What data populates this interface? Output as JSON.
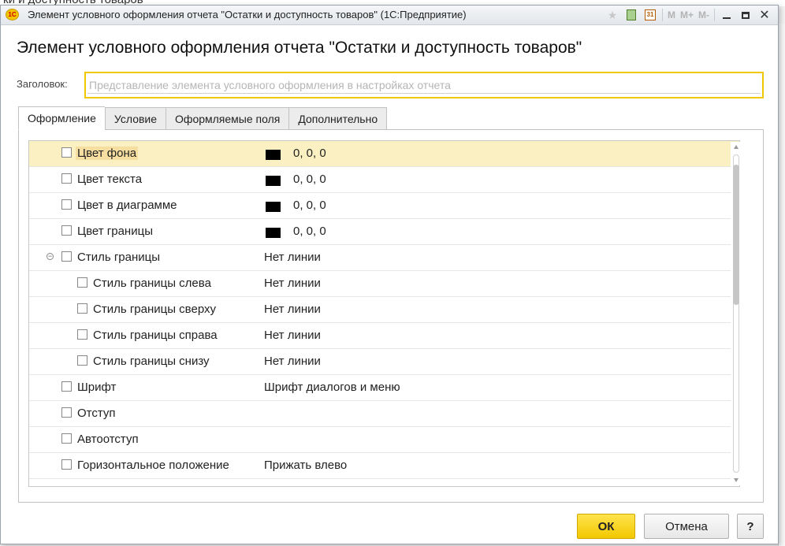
{
  "background": {
    "fragment": "ки и доступность товаров"
  },
  "window": {
    "title": "Элемент условного оформления отчета \"Остатки и доступность товаров\"  (1С:Предприятие)",
    "logo": "1С",
    "toolbar_icons": [
      "favorite-icon",
      "calculator-icon",
      "calendar-icon",
      "memory-m-icon",
      "memory-plus-icon",
      "memory-minus-icon",
      "minimize-icon",
      "maximize-icon",
      "close-icon"
    ],
    "calendar_day": "31",
    "memory": {
      "m": "M",
      "mplus": "M+",
      "mminus": "M-"
    }
  },
  "heading": "Элемент условного оформления отчета \"Остатки и доступность товаров\"",
  "caption": {
    "label": "Заголовок:",
    "value": "",
    "placeholder": "Представление элемента условного оформления в настройках отчета"
  },
  "tabs": [
    {
      "label": "Оформление",
      "active": true
    },
    {
      "label": "Условие",
      "active": false
    },
    {
      "label": "Оформляемые поля",
      "active": false
    },
    {
      "label": "Дополнительно",
      "active": false
    }
  ],
  "rows": [
    {
      "name": "Цвет фона",
      "value": "0, 0, 0",
      "swatch_color": "#000000",
      "checked": false,
      "indent": 0,
      "selected": true
    },
    {
      "name": "Цвет текста",
      "value": "0, 0, 0",
      "swatch_color": "#000000",
      "checked": false,
      "indent": 0
    },
    {
      "name": "Цвет в диаграмме",
      "value": "0, 0, 0",
      "swatch_color": "#000000",
      "checked": false,
      "indent": 0
    },
    {
      "name": "Цвет границы",
      "value": "0, 0, 0",
      "swatch_color": "#000000",
      "checked": false,
      "indent": 0
    },
    {
      "name": "Стиль границы",
      "value": "Нет линии",
      "checked": false,
      "indent": 0,
      "expandable": true,
      "expanded": true
    },
    {
      "name": "Стиль границы слева",
      "value": "Нет линии",
      "checked": false,
      "indent": 1
    },
    {
      "name": "Стиль границы сверху",
      "value": "Нет линии",
      "checked": false,
      "indent": 1
    },
    {
      "name": "Стиль границы справа",
      "value": "Нет линии",
      "checked": false,
      "indent": 1
    },
    {
      "name": "Стиль границы снизу",
      "value": "Нет линии",
      "checked": false,
      "indent": 1
    },
    {
      "name": "Шрифт",
      "value": "Шрифт диалогов и меню",
      "checked": false,
      "indent": 0
    },
    {
      "name": "Отступ",
      "value": "",
      "checked": false,
      "indent": 0
    },
    {
      "name": "Автоотступ",
      "value": "",
      "checked": false,
      "indent": 0
    },
    {
      "name": "Горизонтальное положение",
      "value": "Прижать влево",
      "checked": false,
      "indent": 0
    }
  ],
  "buttons": {
    "ok": "ОК",
    "cancel": "Отмена",
    "help": "?"
  },
  "colors": {
    "accent": "#f2c800",
    "selection": "#fbf0c1",
    "selection_text_bg": "#f5dea0"
  }
}
